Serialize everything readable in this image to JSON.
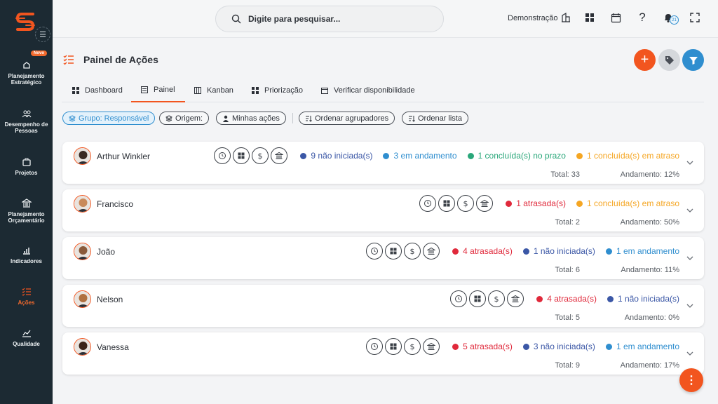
{
  "sidebar": {
    "new_badge": "Novo",
    "items": [
      {
        "label": "Planejamento Estratégico",
        "icon": "strategy-icon"
      },
      {
        "label": "Desempenho de Pessoas",
        "icon": "people-icon"
      },
      {
        "label": "Projetos",
        "icon": "briefcase-icon"
      },
      {
        "label": "Planejamento Orçamentário",
        "icon": "bank-icon"
      },
      {
        "label": "Indicadores",
        "icon": "bar-chart-icon"
      },
      {
        "label": "Ações",
        "icon": "checklist-icon",
        "active": true
      },
      {
        "label": "Qualidade",
        "icon": "line-chart-icon"
      }
    ]
  },
  "topbar": {
    "search_placeholder": "Digite para pesquisar...",
    "company": "Demonstração",
    "notifications_count": "21"
  },
  "page": {
    "title": "Painel de Ações",
    "tabs": [
      {
        "label": "Dashboard"
      },
      {
        "label": "Painel",
        "active": true
      },
      {
        "label": "Kanban"
      },
      {
        "label": "Priorização"
      },
      {
        "label": "Verificar disponibilidade"
      }
    ],
    "filters": {
      "group": "Grupo: Responsável",
      "origin": "Origem:",
      "mine": "Minhas ações",
      "sort_groups": "Ordenar agrupadores",
      "sort_list": "Ordenar lista"
    }
  },
  "colors": {
    "accent": "#f2551f",
    "blue": "#2f8ecf",
    "navy": "#3b57a6",
    "red": "#e0293b",
    "green": "#2aa77a",
    "orange": "#f5a623"
  },
  "people": [
    {
      "name": "Arthur Winkler",
      "stats": [
        {
          "text": "9 não iniciada(s)",
          "color": "#3b57a6"
        },
        {
          "text": "3 em andamento",
          "color": "#2f8ecf"
        },
        {
          "text": "1 concluída(s) no prazo",
          "color": "#2aa77a"
        },
        {
          "text": "1 concluída(s) em atraso",
          "color": "#f5a623"
        }
      ],
      "total": "Total: 33",
      "progress": "Andamento: 12%"
    },
    {
      "name": "Francisco",
      "stats": [
        {
          "text": "1 atrasada(s)",
          "color": "#e0293b"
        },
        {
          "text": "1 concluída(s) em atraso",
          "color": "#f5a623"
        }
      ],
      "total": "Total: 2",
      "progress": "Andamento: 50%"
    },
    {
      "name": "João",
      "stats": [
        {
          "text": "4 atrasada(s)",
          "color": "#e0293b"
        },
        {
          "text": "1 não iniciada(s)",
          "color": "#3b57a6"
        },
        {
          "text": "1 em andamento",
          "color": "#2f8ecf"
        }
      ],
      "total": "Total: 6",
      "progress": "Andamento: 11%"
    },
    {
      "name": "Nelson",
      "stats": [
        {
          "text": "4 atrasada(s)",
          "color": "#e0293b"
        },
        {
          "text": "1 não iniciada(s)",
          "color": "#3b57a6"
        }
      ],
      "total": "Total: 5",
      "progress": "Andamento: 0%"
    },
    {
      "name": "Vanessa",
      "stats": [
        {
          "text": "5 atrasada(s)",
          "color": "#e0293b"
        },
        {
          "text": "3 não iniciada(s)",
          "color": "#3b57a6"
        },
        {
          "text": "1 em andamento",
          "color": "#2f8ecf"
        }
      ],
      "total": "Total: 9",
      "progress": "Andamento: 17%"
    }
  ]
}
